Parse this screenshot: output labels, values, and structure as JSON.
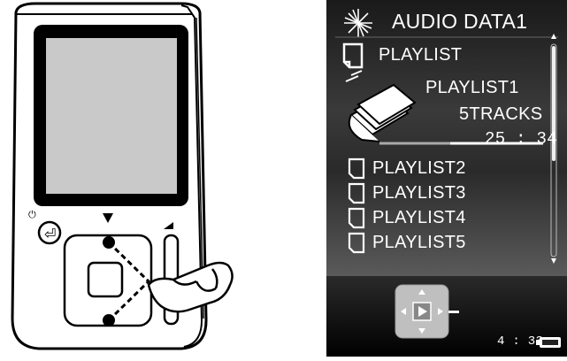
{
  "device": {
    "power_symbol": "⏻"
  },
  "screen": {
    "title": "AUDIO DATA1",
    "header": "PLAYLIST",
    "selected": {
      "name": "PLAYLIST1",
      "tracks": "5TRACKS",
      "duration": "25 : 34"
    },
    "items": [
      {
        "label": "PLAYLIST2"
      },
      {
        "label": "PLAYLIST3"
      },
      {
        "label": "PLAYLIST4"
      },
      {
        "label": "PLAYLIST5"
      }
    ],
    "clock": "4 : 33"
  },
  "icons": {
    "title": "sparkle-icon",
    "header": "document-icon",
    "selected": "playlist-stack-icon",
    "item": "document-icon",
    "nav": "navigation-pad-icon",
    "battery": "battery-icon"
  }
}
